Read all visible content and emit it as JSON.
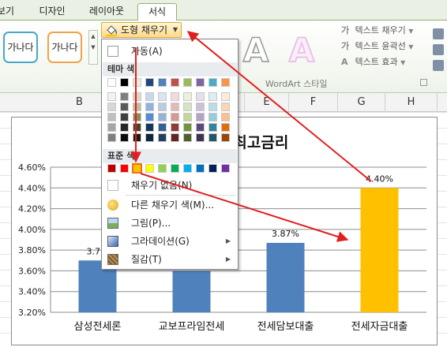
{
  "tabs": [
    "보기",
    "디자인",
    "레이아웃",
    "서식"
  ],
  "ribbon": {
    "shape_style_1": "가나다",
    "shape_style_2": "가나다",
    "fill_button": "도형 채우기",
    "text_fill": "텍스트 채우기",
    "text_outline": "텍스트 윤곽선",
    "text_effects": "텍스트 효과",
    "wordart_group": "WordArt 스타일",
    "wordart_glyph": "A"
  },
  "columns": [
    "B",
    "C",
    "D",
    "E",
    "F",
    "G",
    "H"
  ],
  "menu": {
    "auto": "자동(A)",
    "theme_header": "테마 색",
    "standard_header": "표준 색",
    "no_fill": "채우기 없음(N)",
    "more_colors": "다른 채우기 색(M)...",
    "picture": "그림(P)...",
    "gradient": "그라데이션(G)",
    "texture": "질감(T)",
    "theme_top_row": [
      "#ffffff",
      "#000000",
      "#eeece1",
      "#1f497d",
      "#4f81bd",
      "#c0504d",
      "#9bbb59",
      "#8064a2",
      "#4bacc6",
      "#f79646"
    ],
    "theme_shades": [
      [
        "#f2f2f2",
        "#7f7f7f",
        "#ddd9c3",
        "#c6d9f0",
        "#dbe5f1",
        "#f2dcdb",
        "#ebf1dd",
        "#e5e0ec",
        "#dbeef3",
        "#fdeada"
      ],
      [
        "#d8d8d8",
        "#595959",
        "#c4bd97",
        "#8db3e2",
        "#b8cce4",
        "#e5b9b7",
        "#d7e3bc",
        "#ccc1d9",
        "#b7dde8",
        "#fbd5b5"
      ],
      [
        "#bfbfbf",
        "#3f3f3f",
        "#938953",
        "#548dd4",
        "#95b3d7",
        "#d99694",
        "#c3d69b",
        "#b2a2c7",
        "#92cddc",
        "#fac08f"
      ],
      [
        "#a5a5a5",
        "#262626",
        "#494429",
        "#17365d",
        "#366092",
        "#953734",
        "#76923c",
        "#5f497a",
        "#31859b",
        "#e36c09"
      ],
      [
        "#7f7f7f",
        "#0c0c0c",
        "#1d1b10",
        "#0f243e",
        "#244061",
        "#632423",
        "#4f6128",
        "#3f3151",
        "#205867",
        "#974806"
      ]
    ],
    "standard_colors": [
      "#c00000",
      "#ff0000",
      "#ffc000",
      "#ffff00",
      "#92d050",
      "#00b050",
      "#00b0f0",
      "#0070c0",
      "#002060",
      "#7030a0"
    ]
  },
  "chart_data": {
    "type": "bar",
    "title": "...담대출 최고금리",
    "categories": [
      "삼성전세론",
      "교보프라임전세",
      "전세담보대출",
      "전세자금대출"
    ],
    "values": [
      3.7,
      3.6,
      3.87,
      4.4
    ],
    "data_labels": [
      "3.7...",
      "",
      "3.87%",
      "4.40%"
    ],
    "bar_colors": [
      "#4f81bd",
      "#4f81bd",
      "#4f81bd",
      "#ffc000"
    ],
    "ylim": [
      3.2,
      4.6
    ],
    "yticks": [
      "3.20%",
      "3.40%",
      "3.60%",
      "3.80%",
      "4.00%",
      "4.20%",
      "4.40%",
      "4.60%"
    ],
    "grid": true
  },
  "colors": {
    "annotation_arrow": "#e02020",
    "selected_swatch_border": "#e8731a"
  }
}
